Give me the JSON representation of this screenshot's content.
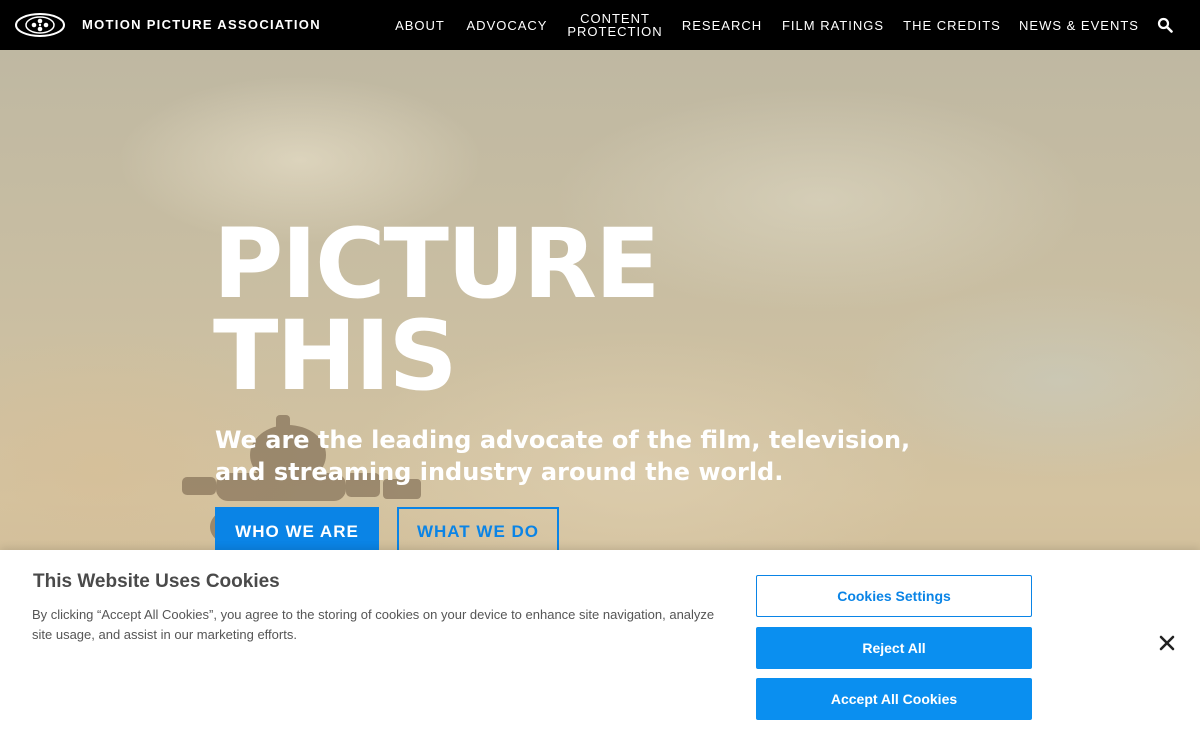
{
  "header": {
    "brand": "MOTION PICTURE ASSOCIATION",
    "logo_icon": "mpa-reel-logo-icon",
    "nav": [
      {
        "label": "ABOUT"
      },
      {
        "label": "ADVOCACY"
      },
      {
        "label_line1": "CONTENT",
        "label_line2": "PROTECTION"
      },
      {
        "label": "RESEARCH"
      },
      {
        "label": "FILM RATINGS"
      },
      {
        "label": "THE CREDITS"
      },
      {
        "label": "NEWS & EVENTS"
      }
    ],
    "search_icon": "search-icon"
  },
  "hero": {
    "title_line1": "PICTURE",
    "title_line2": "THIS",
    "subtitle": "We are the leading advocate of the film, television, and streaming industry around the world.",
    "primary_button": "WHO WE ARE",
    "secondary_button": "WHAT WE DO"
  },
  "cookie_banner": {
    "title": "This Website Uses Cookies",
    "text": "By clicking “Accept All Cookies”, you agree to the storing of cookies on your device to enhance site navigation, analyze site usage, and assist in our marketing efforts.",
    "settings_button": "Cookies Settings",
    "reject_button": "Reject All",
    "accept_button": "Accept All Cookies",
    "close_icon": "close-icon"
  },
  "colors": {
    "accent": "#0a84e6",
    "nav_background": "#000000",
    "hero_text": "#ffffff"
  }
}
